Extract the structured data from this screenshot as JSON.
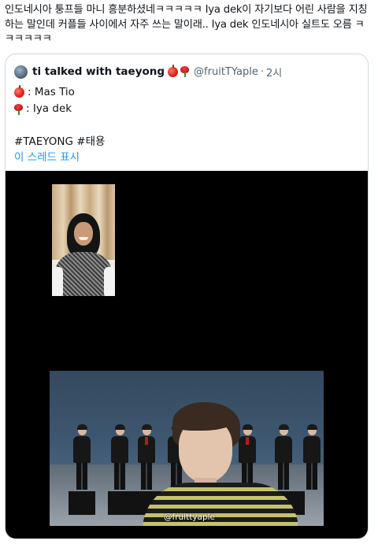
{
  "post": {
    "text": "인도네시아 퉁프들 마니 흥분하셨네ㅋㅋㅋㅋㅋ Iya dek이 자기보다 어린 사람을 지칭하는 말인데 커플들 사이에서 자주 쓰는 말이래.. Iya dek 인도네시아 실트도 오름 ㅋㅋㅋㅋㅋㅋ"
  },
  "quote": {
    "author_name": "ti talked with taeyong",
    "handle": "@fruitTYaple",
    "separator": "·",
    "time": "2시",
    "line1": ": Mas Tio",
    "line2": ": Iya dek",
    "hashtags": "#TAEYONG #태용",
    "thread_link": "이 스레드 표시",
    "icons": [
      "avatar",
      "apple-emoji",
      "rose-emoji"
    ]
  },
  "video": {
    "watermark": "@fruittyaple"
  }
}
